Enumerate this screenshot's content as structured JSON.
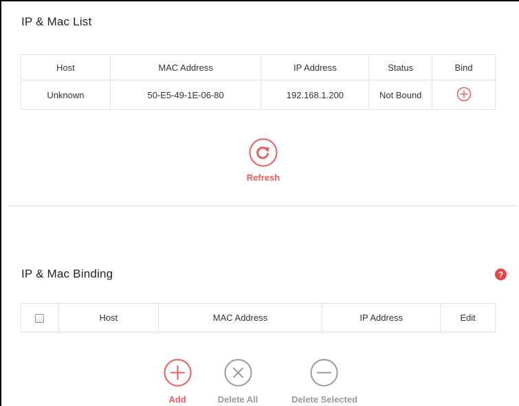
{
  "ip_mac_list": {
    "title": "IP & Mac List",
    "columns": [
      "Host",
      "MAC Address",
      "IP Address",
      "Status",
      "Bind"
    ],
    "rows": [
      {
        "host": "Unknown",
        "mac": "50-E5-49-1E-06-80",
        "ip": "192.168.1.200",
        "status": "Not Bound",
        "bind_icon": "plus-circle-icon"
      }
    ],
    "refresh_label": "Refresh"
  },
  "ip_mac_binding": {
    "title": "IP & Mac Binding",
    "help_glyph": "?",
    "columns": [
      "Host",
      "MAC Address",
      "IP Address",
      "Edit"
    ],
    "add_label": "Add",
    "delete_all_label": "Delete All",
    "delete_selected_label": "Delete Selected"
  },
  "colors": {
    "accent": "#f05a5a",
    "disabled": "#9a9a9a",
    "border": "#e3e3e3",
    "divider": "#f6d6d6"
  }
}
